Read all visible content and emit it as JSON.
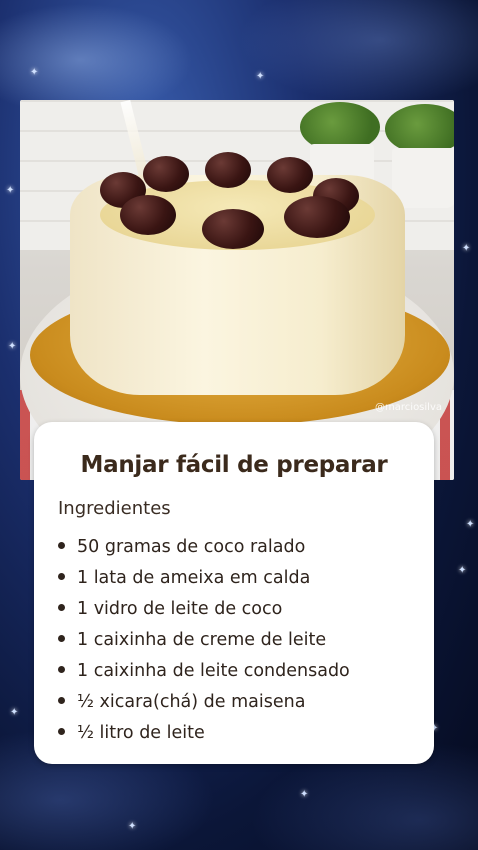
{
  "card": {
    "title": "Manjar fácil de preparar",
    "ingredients_heading": "Ingredientes",
    "ingredients": [
      "50 gramas de coco ralado",
      "1 lata de ameixa em calda",
      "1 vidro de leite de coco",
      "1 caixinha de creme de leite",
      "1 caixinha de leite condensado",
      "½ xicara(chá) de maisena",
      "½ litro de leite"
    ]
  },
  "photo": {
    "watermark": "@marciosilva"
  },
  "colors": {
    "background": "#1b2f6e",
    "card": "#ffffff",
    "title_text": "#3b2a1c",
    "syrup": "#c98b1d"
  }
}
